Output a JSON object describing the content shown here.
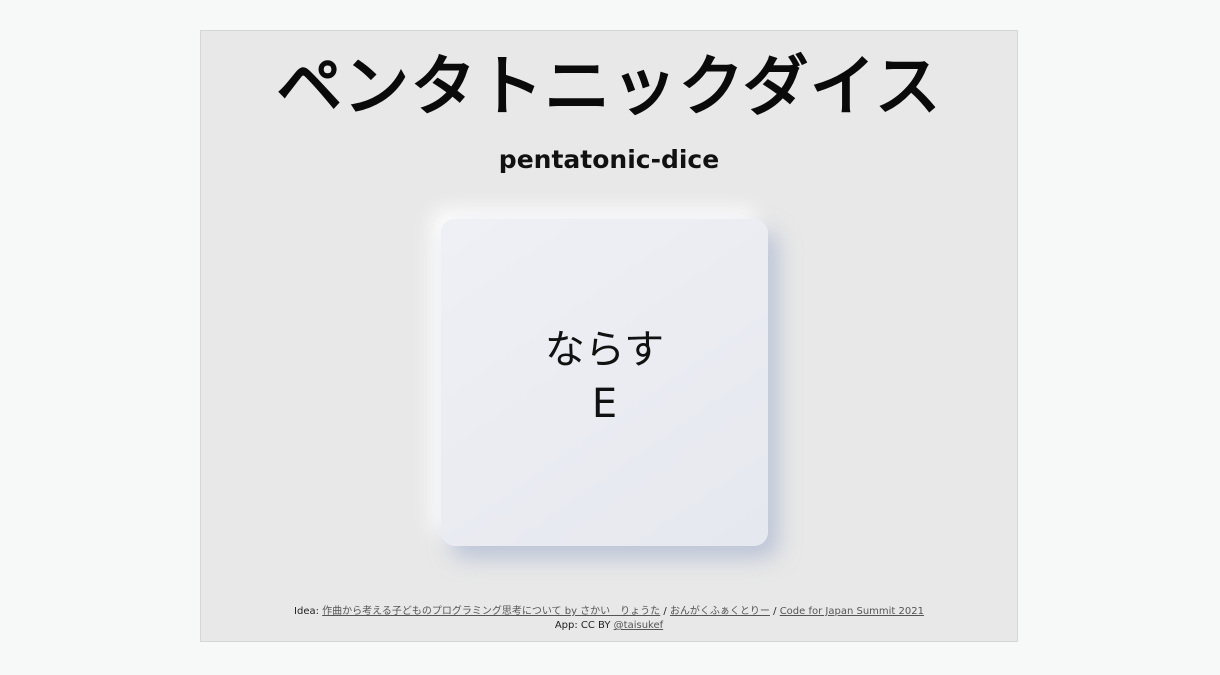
{
  "title": "ペンタトニックダイス",
  "subtitle": "pentatonic-dice",
  "dice": {
    "action": "ならす",
    "note": "E"
  },
  "credits": {
    "idea_prefix": "Idea:",
    "link1": "作曲から考える子どものプログラミング思考について by さかい　りょうた",
    "sep1": "/",
    "link2": "おんがくふぁくとりー",
    "sep2": "/",
    "link3": "Code for Japan Summit 2021",
    "app_prefix": "App: CC BY",
    "author_link": "@taisukef"
  }
}
